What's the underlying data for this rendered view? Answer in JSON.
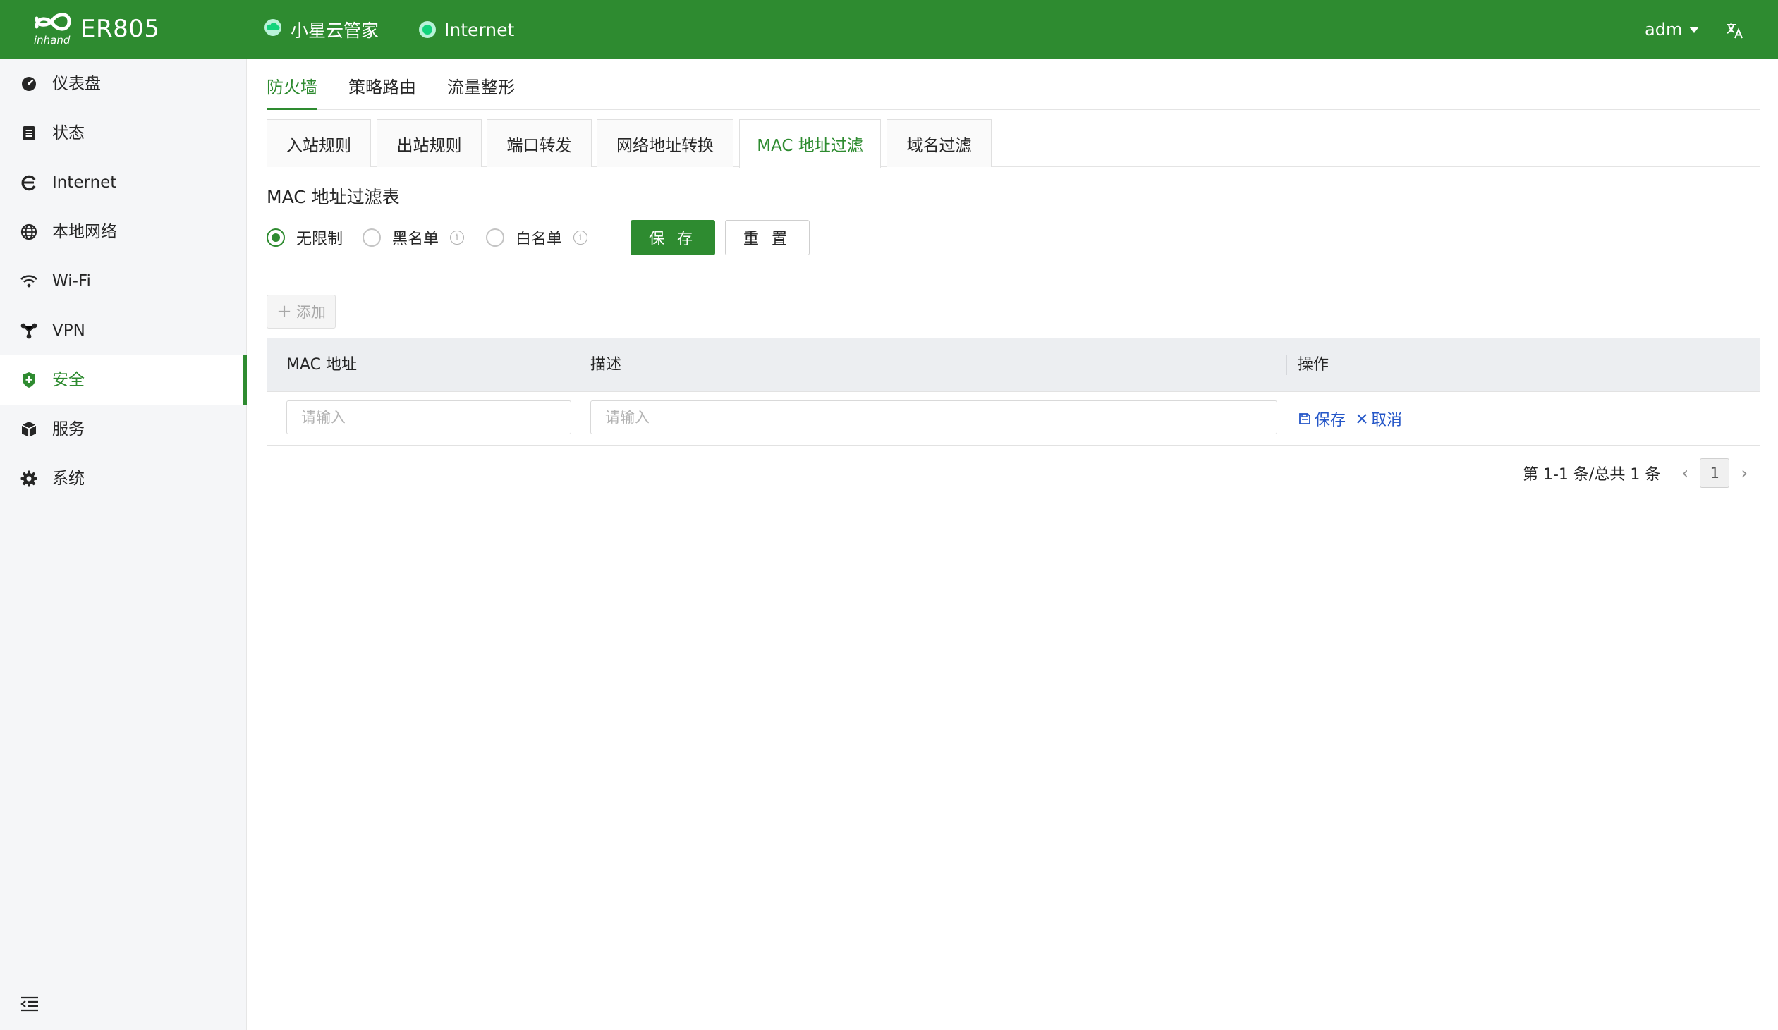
{
  "brand": {
    "model": "ER805",
    "logo_icon": "inhand-logo"
  },
  "header": {
    "cloud_status": {
      "label": "小星云管家",
      "icon": "cloud-icon"
    },
    "internet_status": {
      "label": "Internet",
      "icon": "online-dot"
    },
    "user": "adm",
    "language_icon": "translate-icon",
    "colors": {
      "bar": "#2e8b30",
      "online": "#12d47c"
    }
  },
  "sidebar": {
    "items": [
      {
        "label": "仪表盘",
        "icon": "dashboard-icon"
      },
      {
        "label": "状态",
        "icon": "status-icon"
      },
      {
        "label": "Internet",
        "icon": "internet-icon"
      },
      {
        "label": "本地网络",
        "icon": "globe-icon"
      },
      {
        "label": "Wi-Fi",
        "icon": "wifi-icon"
      },
      {
        "label": "VPN",
        "icon": "vpn-icon"
      },
      {
        "label": "安全",
        "icon": "shield-icon",
        "active": true
      },
      {
        "label": "服务",
        "icon": "box-icon"
      },
      {
        "label": "系统",
        "icon": "gear-icon"
      }
    ],
    "collapse_icon": "menu-collapse-icon"
  },
  "top_tabs": [
    {
      "label": "防火墙",
      "active": true
    },
    {
      "label": "策略路由"
    },
    {
      "label": "流量整形"
    }
  ],
  "sub_tabs": [
    {
      "label": "入站规则"
    },
    {
      "label": "出站规则"
    },
    {
      "label": "端口转发"
    },
    {
      "label": "网络地址转换"
    },
    {
      "label": "MAC 地址过滤",
      "active": true
    },
    {
      "label": "域名过滤"
    }
  ],
  "section_title": "MAC 地址过滤表",
  "filter_mode": {
    "options": [
      "无限制",
      "黑名单",
      "白名单"
    ],
    "selected": "无限制"
  },
  "buttons": {
    "save": "保 存",
    "reset": "重 置",
    "add": "添加"
  },
  "table": {
    "columns": [
      "MAC 地址",
      "描述",
      "操作"
    ],
    "edit_row": {
      "mac_placeholder": "请输入",
      "desc_placeholder": "请输入",
      "save_label": "保存",
      "cancel_label": "取消"
    }
  },
  "pagination": {
    "summary": "第 1-1 条/总共 1 条",
    "current_page": "1"
  }
}
